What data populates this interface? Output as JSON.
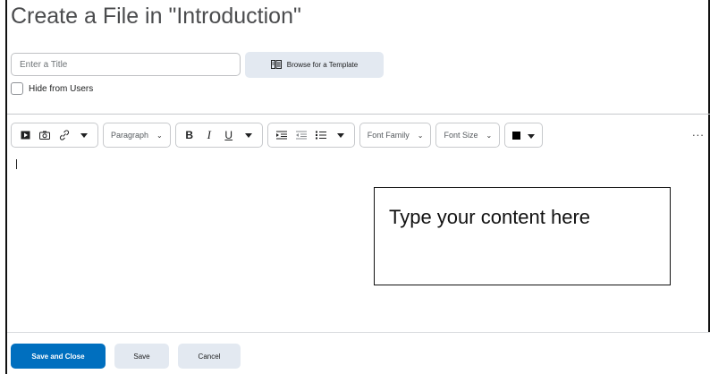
{
  "page": {
    "title": "Create a File in \"Introduction\""
  },
  "form": {
    "title_placeholder": "Enter a Title",
    "title_value": "",
    "browse_template_label": "Browse for a Template",
    "hide_from_users_label": "Hide from Users",
    "hide_from_users_checked": false
  },
  "toolbar": {
    "insert_stuff_icon": "insert-stuff-icon",
    "insert_image_icon": "camera-icon",
    "insert_link_icon": "link-icon",
    "paragraph_label": "Paragraph",
    "bold_label": "B",
    "italic_label": "I",
    "underline_label": "U",
    "font_family_label": "Font Family",
    "font_size_label": "Font Size",
    "color_swatch": "#000000",
    "more_label": "..."
  },
  "editor": {
    "annotation_text": "Type your content here"
  },
  "footer": {
    "save_and_close_label": "Save and Close",
    "save_label": "Save",
    "cancel_label": "Cancel"
  },
  "colors": {
    "primary_button": "#006fbf",
    "secondary_button": "#e3e9f1",
    "border": "#c7c9cc"
  }
}
